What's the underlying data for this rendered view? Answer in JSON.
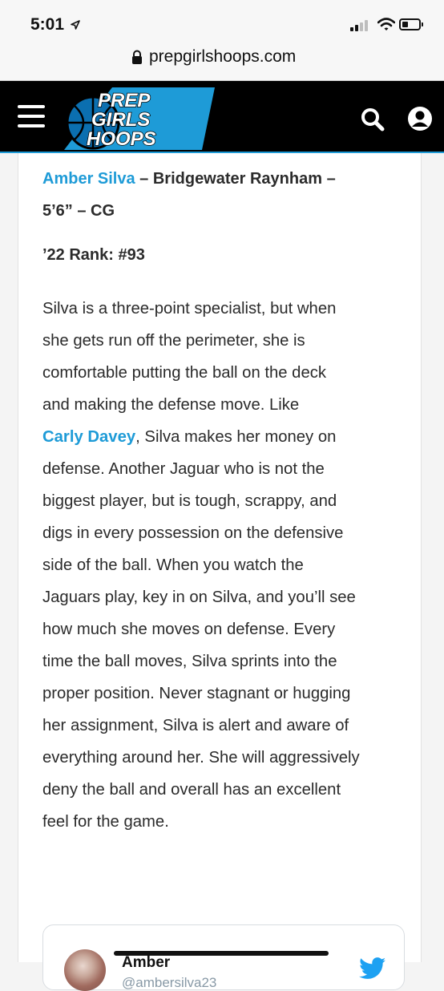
{
  "status_bar": {
    "time": "5:01"
  },
  "browser": {
    "url": "prepgirlshoops.com"
  },
  "header": {
    "logo_lines": [
      "PREP",
      "GIRLS",
      "HOOPS"
    ],
    "colors": {
      "background": "#000000",
      "accent": "#1e9bd7"
    }
  },
  "article": {
    "player_name": "Amber Silva",
    "headline_rest_1": " – Bridgewater Raynham –",
    "headline_rest_2": "5’6” – CG",
    "rank": "’22 Rank: #93",
    "body": {
      "l1": "Silva is a three-point specialist, but when",
      "l2": "she gets run off the perimeter, she is",
      "l3": "comfortable putting the ball on the deck",
      "l4": "and making the defense move. Like",
      "l5_link": "Carly Davey",
      "l5_rest": ", Silva makes her money on",
      "l6": "defense. Another Jaguar who is not the",
      "l7": "biggest player, but is tough, scrappy, and",
      "l8": "digs in every possession on the defensive",
      "l9": "side of the ball. When you watch the",
      "l10": "Jaguars play, key in on Silva, and you’ll see",
      "l11": "how much she moves on defense. Every",
      "l12": "time the ball moves, Silva sprints into the",
      "l13": "proper position. Never stagnant or hugging",
      "l14": "her assignment, Silva is alert and aware of",
      "l15": "everything around her. She will aggressively",
      "l16": "deny the ball and overall has an excellent",
      "l17": "feel for the game."
    }
  },
  "tweet": {
    "name": "Amber",
    "handle": "@ambersilva23",
    "icon": "twitter-bird-icon",
    "accent": "#1da1f2"
  }
}
